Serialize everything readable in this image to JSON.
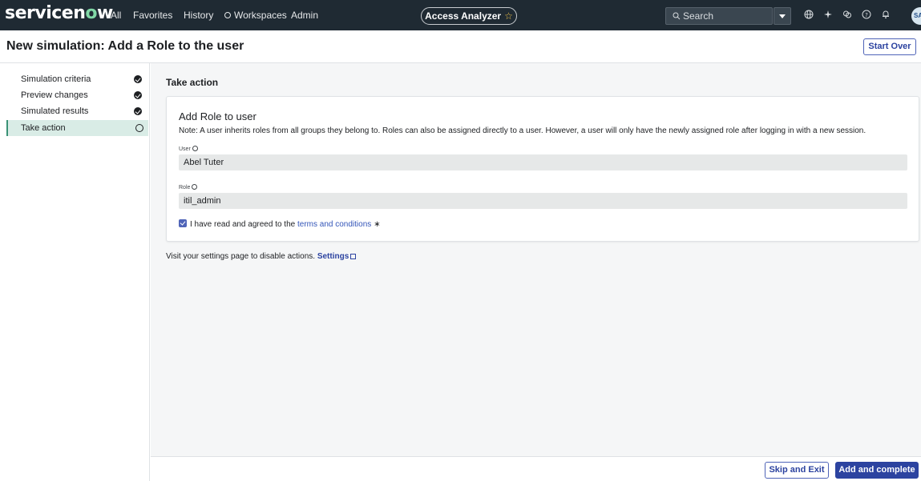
{
  "topnav": {
    "logo_prefix": "servicen",
    "logo_o": "o",
    "logo_suffix": "w",
    "items": [
      "All",
      "Favorites",
      "History",
      "Workspaces",
      "Admin"
    ],
    "pill_label": "Access Analyzer",
    "pill_star": "☆",
    "search_placeholder": "Search",
    "avatar_initials": "SA"
  },
  "header": {
    "title": "New simulation: Add a Role to the user",
    "start_over": "Start Over"
  },
  "steps": [
    {
      "label": "Simulation criteria",
      "status": "complete"
    },
    {
      "label": "Preview changes",
      "status": "complete"
    },
    {
      "label": "Simulated results",
      "status": "complete"
    },
    {
      "label": "Take action",
      "status": "current"
    }
  ],
  "main": {
    "section_title": "Take action",
    "card": {
      "title": "Add Role to user",
      "note": "Note: A user inherits roles from all groups they belong to. Roles can also be assigned directly to a user. However, a user will only have the newly assigned role after logging in with a new session.",
      "user_label": "User",
      "user_value": "Abel Tuter",
      "role_label": "Role",
      "role_value": "itil_admin",
      "agree_prefix": "I have read and agreed to the",
      "agree_link": "terms and conditions",
      "agree_required": "∗",
      "agree_checked": true
    },
    "visit_text": "Visit your settings page to disable actions.",
    "settings_link": "Settings"
  },
  "footer": {
    "skip_label": "Skip and Exit",
    "complete_label": "Add and complete"
  },
  "colors": {
    "nav_bg": "#1f2a33",
    "accent": "#2c43a0",
    "active_step": "#d9ece6"
  }
}
